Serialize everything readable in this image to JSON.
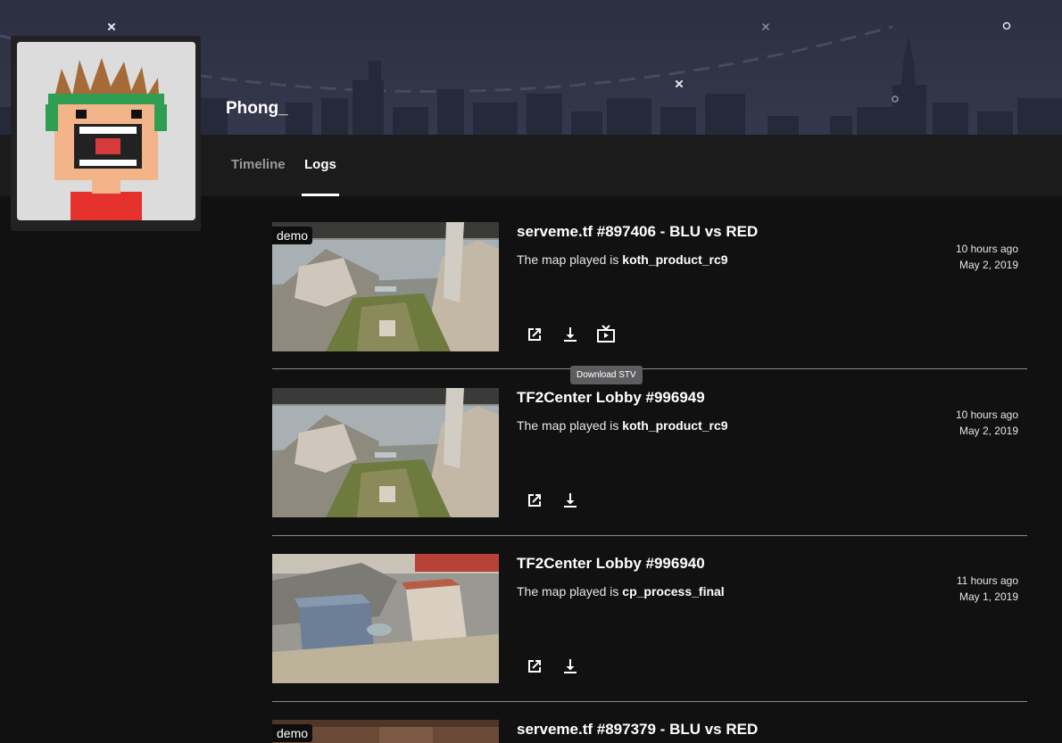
{
  "profile": {
    "username": "Phong_"
  },
  "tabs": [
    {
      "label": "Timeline",
      "active": false
    },
    {
      "label": "Logs",
      "active": true
    }
  ],
  "logs": [
    {
      "badge": "demo",
      "title": "serveme.tf #897406 - BLU vs RED",
      "map_prefix": "The map played is ",
      "map": "koth_product_rc9",
      "ago": "10 hours ago",
      "date": "May 2, 2019",
      "actions": [
        "open-external-icon",
        "download-icon",
        "download-stv-icon"
      ]
    },
    {
      "badge": "",
      "title": "TF2Center Lobby #996949",
      "map_prefix": "The map played is ",
      "map": "koth_product_rc9",
      "ago": "10 hours ago",
      "date": "May 2, 2019",
      "actions": [
        "open-external-icon",
        "download-icon"
      ]
    },
    {
      "badge": "",
      "title": "TF2Center Lobby #996940",
      "map_prefix": "The map played is ",
      "map": "cp_process_final",
      "ago": "11 hours ago",
      "date": "May 1, 2019",
      "actions": [
        "open-external-icon",
        "download-icon"
      ]
    },
    {
      "badge": "demo",
      "title": "serveme.tf #897379 - BLU vs RED",
      "map_prefix": "",
      "map": "",
      "ago": "",
      "date": "",
      "actions": []
    }
  ],
  "tooltip": {
    "text": "Download STV"
  },
  "colors": {
    "background": "#111112",
    "banner": "#30334a",
    "tabbar": "#1b1b1c",
    "accent": "#ffffff"
  }
}
